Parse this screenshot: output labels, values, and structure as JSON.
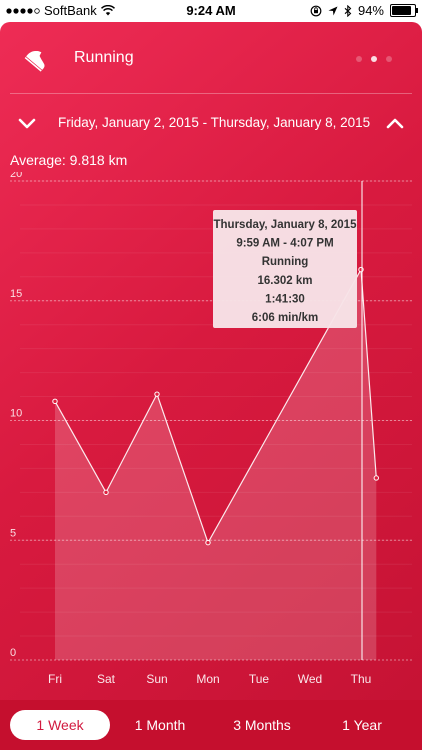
{
  "status_bar": {
    "carrier": "SoftBank",
    "time": "9:24 AM",
    "battery": "94%",
    "battery_level": 0.94
  },
  "header": {
    "title": "Running",
    "activity_icon": "running-shoe-icon",
    "page_dots": 3,
    "active_dot": 1
  },
  "date_range": {
    "label": "Friday, January 2, 2015 - Thursday, January 8, 2015",
    "prev_icon": "chevron-down-icon",
    "next_icon": "chevron-up-icon"
  },
  "average": "Average: 9.818 km",
  "tooltip": {
    "date": "Thursday, January 8, 2015",
    "time": "9:59 AM - 4:07 PM",
    "activity": "Running",
    "distance": "16.302 km",
    "duration": "1:41:30",
    "pace": "6:06 min/km"
  },
  "chart_data": {
    "type": "area",
    "categories": [
      "Fri",
      "Sat",
      "Sun",
      "Mon",
      "Tue",
      "Wed",
      "Thu"
    ],
    "points": [
      {
        "x": 0,
        "y": 10.8
      },
      {
        "x": 1,
        "y": 7.0
      },
      {
        "x": 2,
        "y": 11.1
      },
      {
        "x": 3,
        "y": 4.9
      },
      {
        "x": 6,
        "y": 16.302
      },
      {
        "x": 6.3,
        "y": 7.6
      }
    ],
    "highlight_x": 6,
    "ylim": [
      0,
      20
    ],
    "yticks": [
      "0",
      "5",
      "10",
      "15",
      "20"
    ],
    "grid": true
  },
  "range_tabs": [
    "1 Week",
    "1 Month",
    "3 Months",
    "1 Year"
  ],
  "selected_tab": 0,
  "colors": {
    "background": "#d81a3f",
    "accent": "#ffffff"
  }
}
